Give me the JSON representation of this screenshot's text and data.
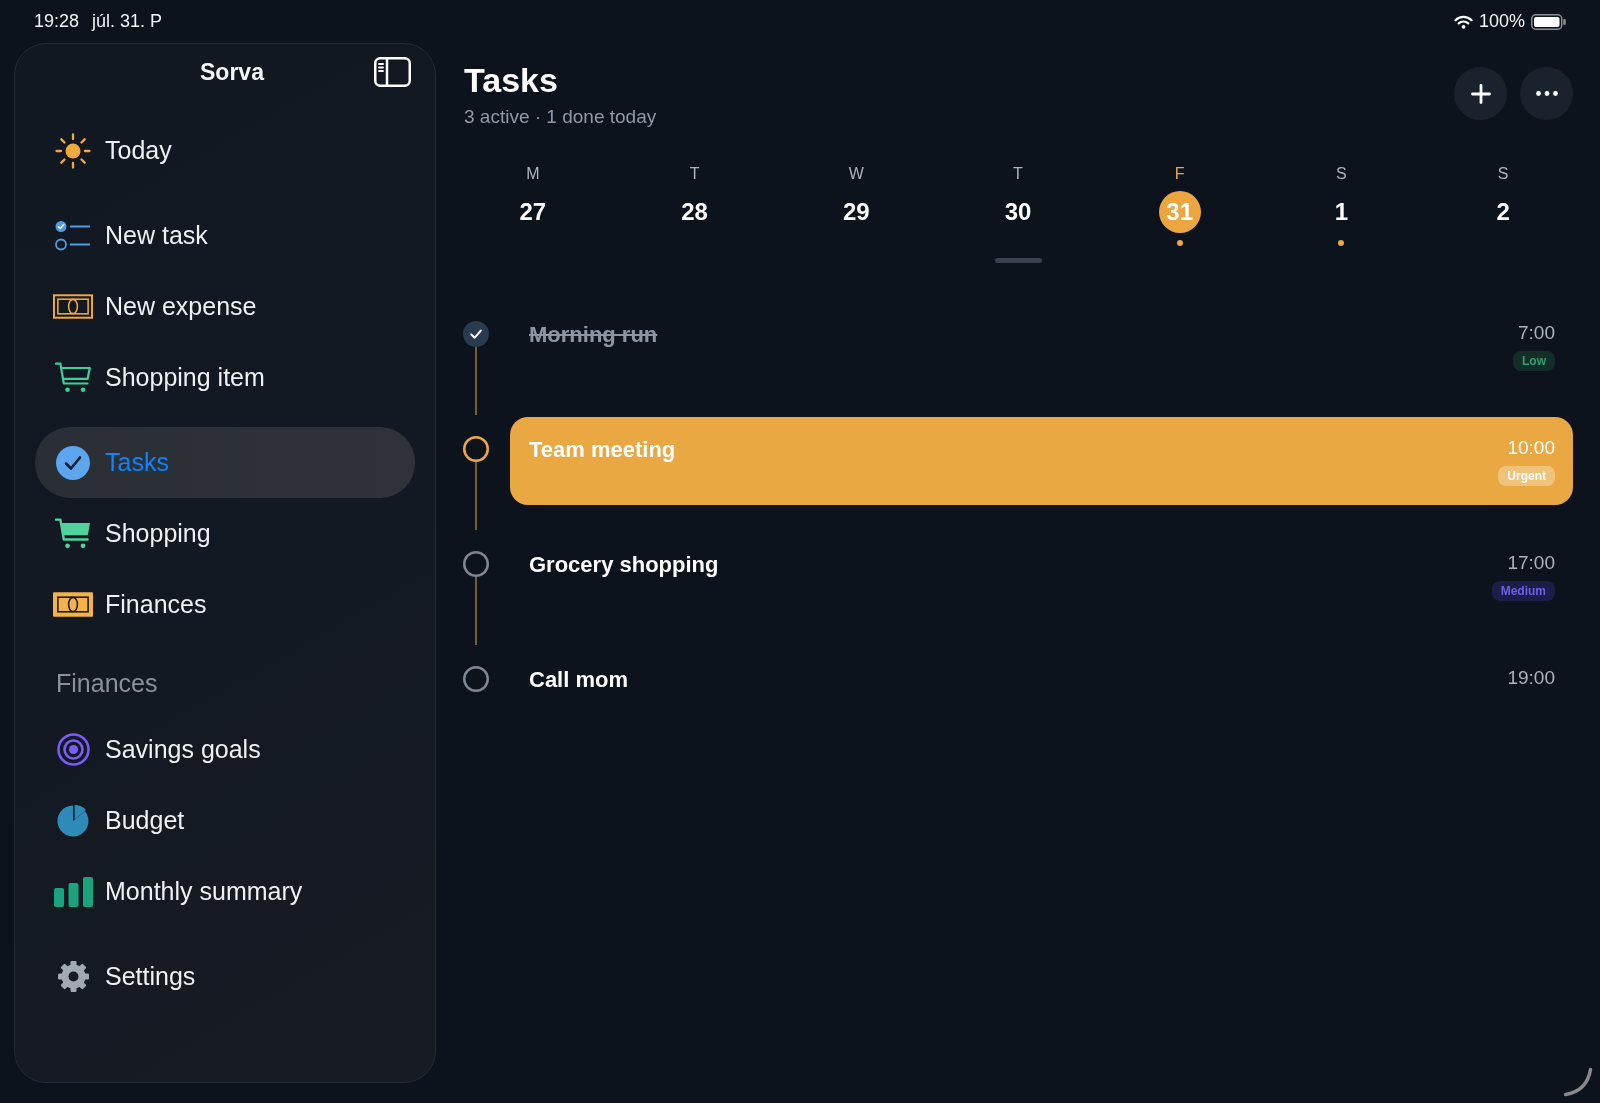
{
  "status_bar": {
    "time": "19:28",
    "date": "júl. 31. P",
    "battery": "100%"
  },
  "sidebar": {
    "title": "Sorva",
    "sections": [
      {
        "items": [
          {
            "label": "Today",
            "selected": false
          }
        ]
      },
      {
        "items": [
          {
            "label": "New task",
            "selected": false
          },
          {
            "label": "New expense",
            "selected": false
          },
          {
            "label": "Shopping item",
            "selected": false
          }
        ]
      },
      {
        "items": [
          {
            "label": "Tasks",
            "selected": true
          },
          {
            "label": "Shopping",
            "selected": false
          },
          {
            "label": "Finances",
            "selected": false
          }
        ]
      },
      {
        "heading": "Finances",
        "items": [
          {
            "label": "Savings goals",
            "selected": false
          },
          {
            "label": "Budget",
            "selected": false
          },
          {
            "label": "Monthly summary",
            "selected": false
          }
        ]
      },
      {
        "items": [
          {
            "label": "Settings",
            "selected": false
          }
        ]
      }
    ]
  },
  "header": {
    "title": "Tasks",
    "subtitle": "3 active · 1 done today"
  },
  "week": [
    {
      "weekday": "M",
      "day": "27",
      "selected": false,
      "has_tasks": false
    },
    {
      "weekday": "T",
      "day": "28",
      "selected": false,
      "has_tasks": false
    },
    {
      "weekday": "W",
      "day": "29",
      "selected": false,
      "has_tasks": false
    },
    {
      "weekday": "T",
      "day": "30",
      "selected": false,
      "has_tasks": false
    },
    {
      "weekday": "F",
      "day": "31",
      "selected": true,
      "has_tasks": true
    },
    {
      "weekday": "S",
      "day": "1",
      "selected": false,
      "has_tasks": true
    },
    {
      "weekday": "S",
      "day": "2",
      "selected": false,
      "has_tasks": false
    }
  ],
  "tasks": [
    {
      "title": "Morning run",
      "time": "7:00",
      "done": true,
      "selected": false,
      "priority": {
        "label": "Low",
        "kind": "low"
      }
    },
    {
      "title": "Team meeting",
      "time": "10:00",
      "done": false,
      "selected": true,
      "priority": {
        "label": "Urgent",
        "kind": "urgent"
      }
    },
    {
      "title": "Grocery shopping",
      "time": "17:00",
      "done": false,
      "selected": false,
      "priority": {
        "label": "Medium",
        "kind": "medium"
      }
    },
    {
      "title": "Call mom",
      "time": "19:00",
      "done": false,
      "selected": false
    }
  ]
}
